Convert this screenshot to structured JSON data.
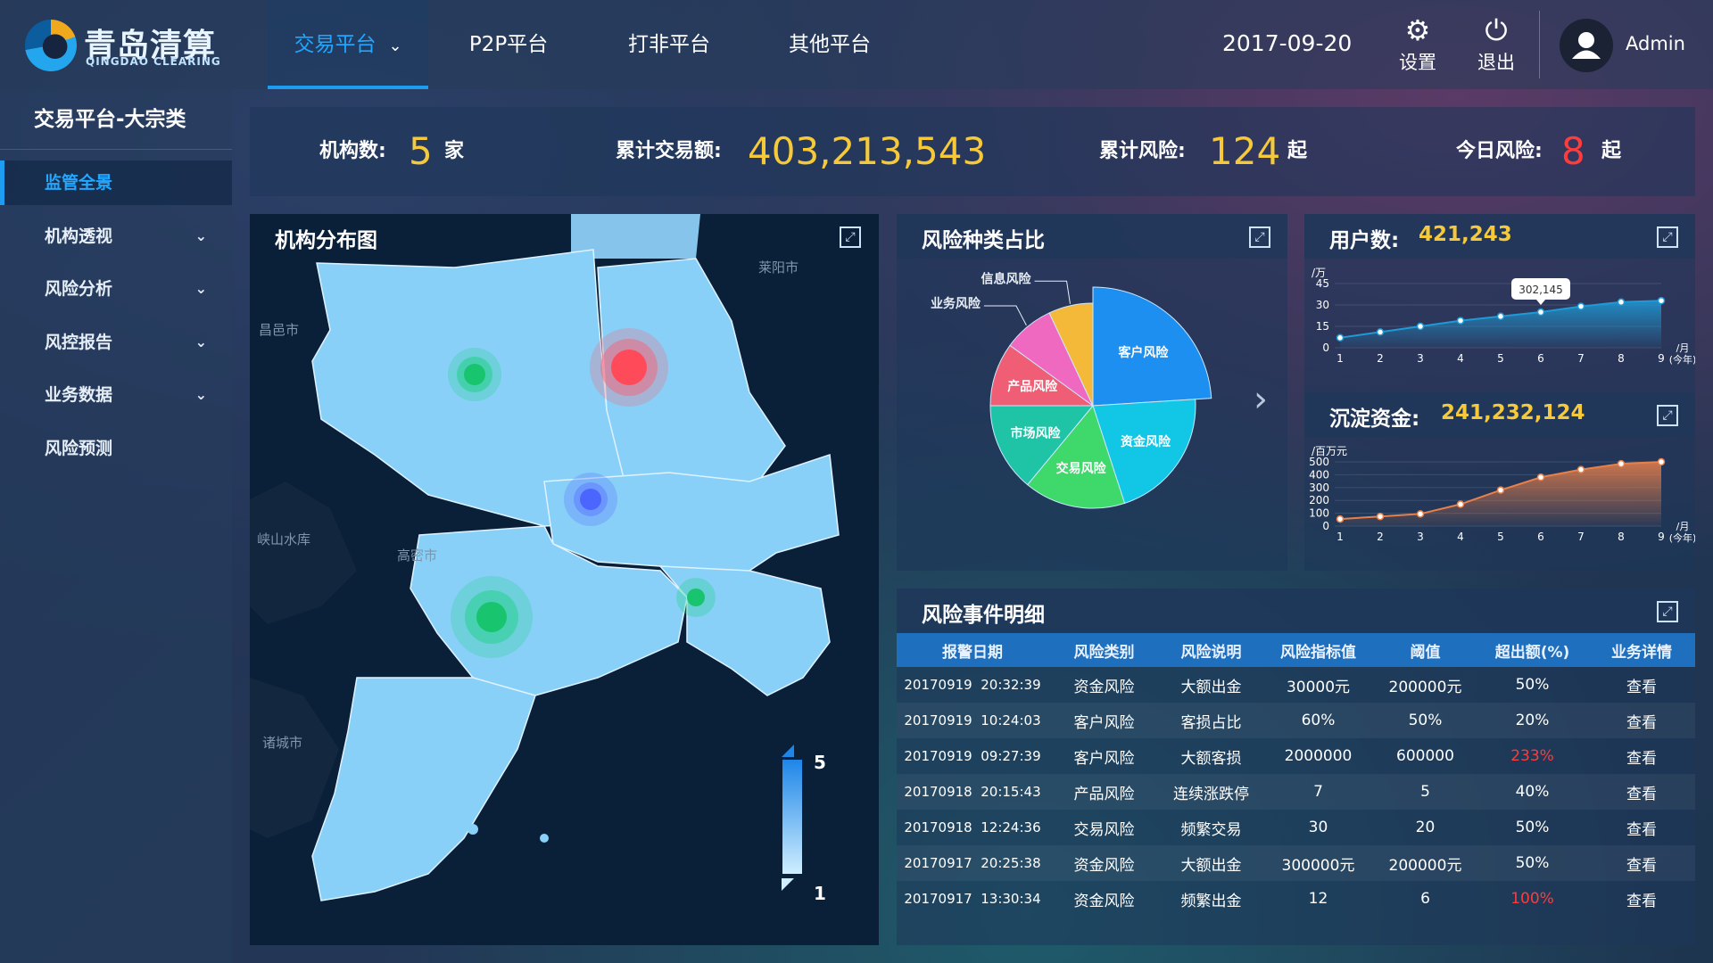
{
  "app": {
    "logo_title": "青岛清算",
    "logo_sub": "QINGDAO CLEARING"
  },
  "nav": {
    "items": [
      "交易平台",
      "P2P平台",
      "打非平台",
      "其他平台"
    ],
    "date": "2017-09-20",
    "settings": "设置",
    "logout": "退出",
    "user": "Admin"
  },
  "sidebar": {
    "title": "交易平台-大宗类",
    "items": [
      "监管全景",
      "机构透视",
      "风险分析",
      "风控报告",
      "业务数据",
      "风险预测"
    ]
  },
  "stats": {
    "org_label": "机构数:",
    "org_value": "5",
    "org_unit": "家",
    "trade_label": "累计交易额:",
    "trade_value": "403,213,543",
    "risk_label": "累计风险:",
    "risk_value": "124",
    "risk_unit": "起",
    "today_label": "今日风险:",
    "today_value": "8",
    "today_unit": "起"
  },
  "map": {
    "title": "机构分布图",
    "cities": [
      "莱阳市",
      "昌邑市",
      "峡山水库",
      "高密市",
      "诸城市"
    ],
    "legend_max": "5",
    "legend_min": "1"
  },
  "pie": {
    "title": "风险种类占比"
  },
  "users": {
    "title": "用户数:",
    "value": "421,243",
    "yunit": "/万",
    "xunit": "/月",
    "xunit2": "(今年)",
    "tooltip": "302,145"
  },
  "deposit": {
    "title": "沉淀资金:",
    "value": "241,232,124",
    "yunit": "/百万元",
    "xunit": "/月",
    "xunit2": "(今年)"
  },
  "events": {
    "title": "风险事件明细",
    "headers": [
      "报警日期",
      "风险类别",
      "风险说明",
      "风险指标值",
      "阈值",
      "超出额(%)",
      "业务详情"
    ],
    "rows": [
      [
        "20170919  20:32:39",
        "资金风险",
        "大额出金",
        "30000元",
        "200000元",
        "50%",
        "查看"
      ],
      [
        "20170919  10:24:03",
        "客户风险",
        "客损占比",
        "60%",
        "50%",
        "20%",
        "查看"
      ],
      [
        "20170919  09:27:39",
        "客户风险",
        "大额客损",
        "2000000",
        "600000",
        "233%",
        "查看"
      ],
      [
        "20170918  20:15:43",
        "产品风险",
        "连续涨跌停",
        "7",
        "5",
        "40%",
        "查看"
      ],
      [
        "20170918  12:24:36",
        "交易风险",
        "频繁交易",
        "30",
        "20",
        "50%",
        "查看"
      ],
      [
        "20170917  20:25:38",
        "资金风险",
        "大额出金",
        "300000元",
        "200000元",
        "50%",
        "查看"
      ],
      [
        "20170917  13:30:34",
        "资金风险",
        "频繁出金",
        "12",
        "6",
        "100%",
        "查看"
      ]
    ],
    "highlight_color": "#ff3b3b"
  },
  "chart_data": [
    {
      "type": "pie",
      "title": "风险种类占比",
      "categories": [
        "客户风险",
        "资金风险",
        "交易风险",
        "市场风险",
        "产品风险",
        "业务风险",
        "信息风险"
      ],
      "values": [
        24,
        21,
        16,
        14,
        10,
        8,
        7
      ],
      "colors": [
        "#1d8ff0",
        "#12c6e6",
        "#3fd86a",
        "#1fc3a6",
        "#ef5e74",
        "#f069c0",
        "#f5b93a"
      ]
    },
    {
      "type": "area",
      "title": "用户数",
      "x": [
        1,
        2,
        3,
        4,
        5,
        6,
        7,
        8,
        9
      ],
      "values": [
        7,
        11,
        15,
        19,
        22,
        25,
        29,
        32,
        33
      ],
      "ylim": [
        0,
        45
      ],
      "yticks": [
        0,
        15,
        30,
        45
      ],
      "ylabel": "/万",
      "xlabel": "/月(今年)"
    },
    {
      "type": "area",
      "title": "沉淀资金",
      "x": [
        1,
        2,
        3,
        4,
        5,
        6,
        7,
        8,
        9
      ],
      "values": [
        55,
        75,
        95,
        170,
        280,
        380,
        440,
        485,
        500
      ],
      "ylim": [
        0,
        500
      ],
      "yticks": [
        0,
        100,
        200,
        300,
        400,
        500
      ],
      "ylabel": "/百万元",
      "xlabel": "/月(今年)"
    }
  ]
}
